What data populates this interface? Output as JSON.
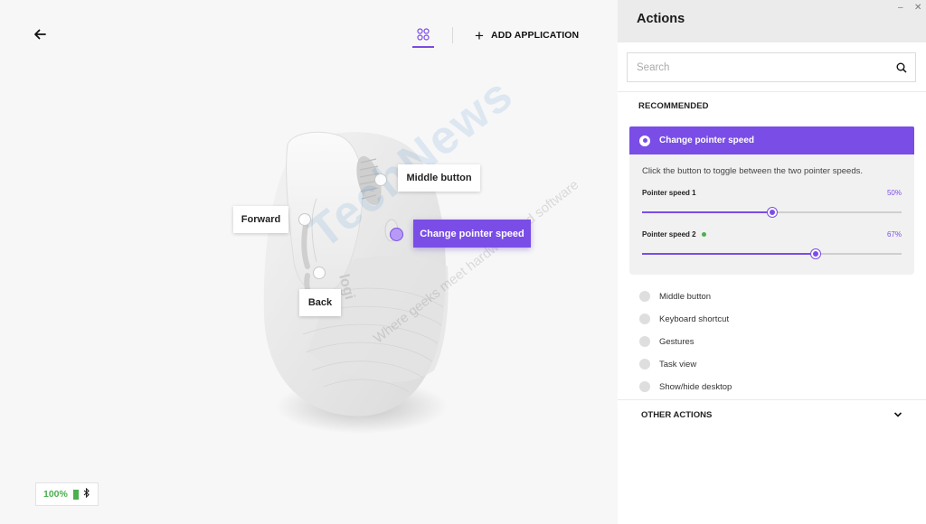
{
  "header": {
    "add_application_label": "ADD APPLICATION",
    "add_icon": "plus-icon",
    "back_icon": "arrow-left-icon",
    "devices_icon": "grid-icon"
  },
  "mouse": {
    "logo_text": "logi",
    "callouts": {
      "middle_button": "Middle button",
      "forward": "Forward",
      "change_pointer_speed": "Change pointer speed",
      "back": "Back"
    }
  },
  "watermark": {
    "brand": "TechNews",
    "tagline": "Where geeks meet hardware and software"
  },
  "status": {
    "battery_percent": "100%",
    "battery_icon": "battery-icon",
    "connection_icon": "bluetooth-icon"
  },
  "actions_panel": {
    "title": "Actions",
    "search_placeholder": "Search",
    "search_value": "",
    "recommended_label": "RECOMMENDED",
    "selected_action": {
      "label": "Change pointer speed",
      "description": "Click the button to toggle between the two pointer speeds.",
      "sliders": [
        {
          "label": "Pointer speed 1",
          "value_text": "50%",
          "value": 0.5,
          "active": false
        },
        {
          "label": "Pointer speed 2",
          "value_text": "67%",
          "value": 0.67,
          "active": true
        }
      ]
    },
    "other_recommended": [
      "Middle button",
      "Keyboard shortcut",
      "Gestures",
      "Task view",
      "Show/hide desktop"
    ],
    "other_actions_label": "OTHER ACTIONS"
  },
  "colors": {
    "accent": "#7a4de6",
    "battery_green": "#4caf50",
    "status_dot_green": "#4caf50"
  }
}
